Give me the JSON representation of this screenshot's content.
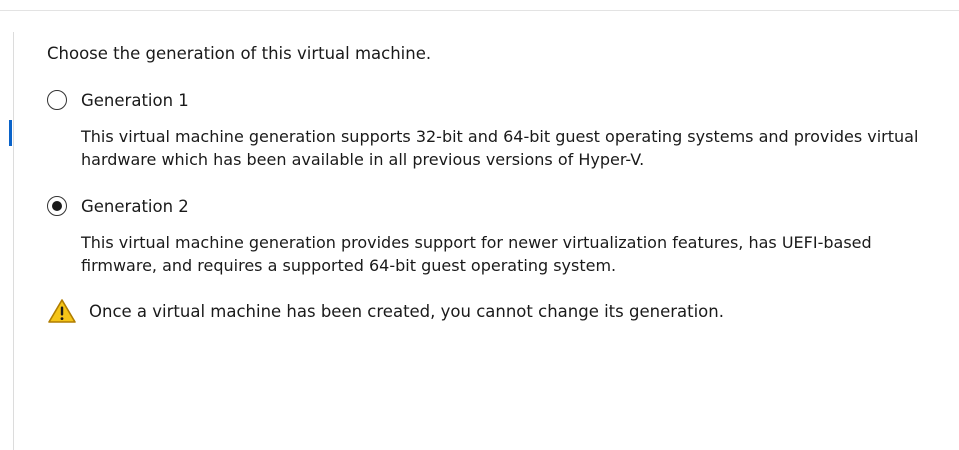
{
  "page": {
    "prompt": "Choose the generation of this virtual machine.",
    "options": [
      {
        "label": "Generation 1",
        "selected": false,
        "description": "This virtual machine generation supports 32-bit and 64-bit guest operating systems and provides virtual hardware which has been available in all previous versions of Hyper-V."
      },
      {
        "label": "Generation 2",
        "selected": true,
        "description": "This virtual machine generation provides support for newer virtualization features, has UEFI-based firmware, and requires a supported 64-bit guest operating system."
      }
    ],
    "warning": {
      "icon": "warning-triangle-icon",
      "text": "Once a virtual machine has been created, you cannot change its generation."
    }
  },
  "colors": {
    "warning_fill": "#f5c518",
    "warning_stroke": "#b07d00",
    "nav_accent": "#0a63c9"
  }
}
